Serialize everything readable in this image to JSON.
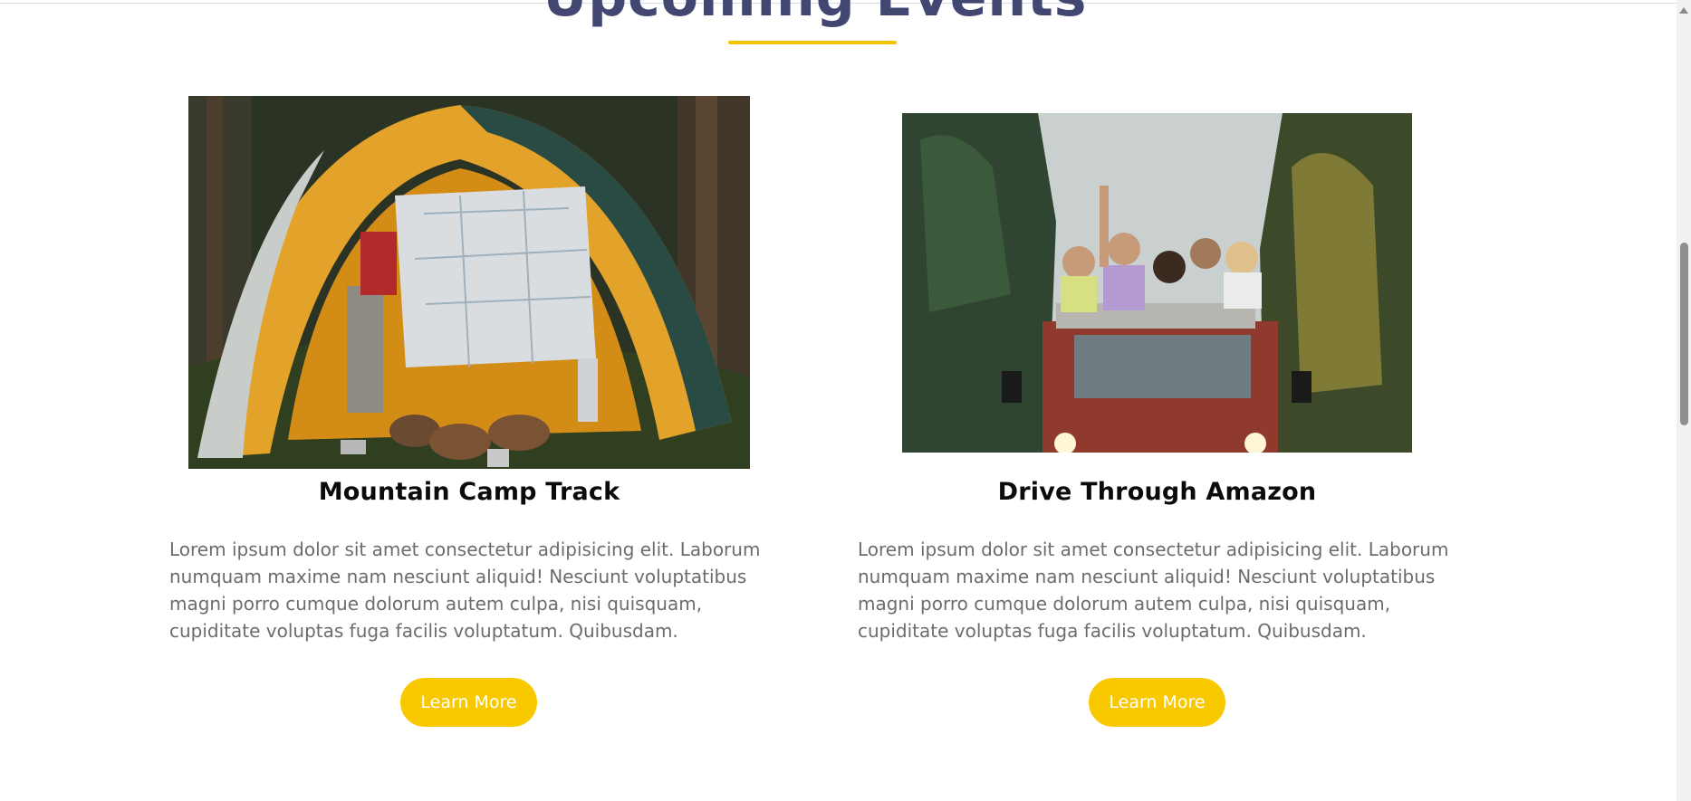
{
  "section": {
    "title": "Upcoming Events"
  },
  "events": [
    {
      "title": "Mountain Camp Track",
      "image_icon": "camping-tent-map-photo",
      "description": "Lorem ipsum dolor sit amet consectetur adipisicing elit. Laborum numquam maxime nam nesciunt aliquid! Nesciunt voluptatibus magni porro cumque dolorum autem culpa, nisi quisquam, cupiditate voluptas fuga facilis voluptatum. Quibusdam.",
      "button_label": "Learn More"
    },
    {
      "title": "Drive Through Amazon",
      "image_icon": "friends-on-van-forest-photo",
      "description": "Lorem ipsum dolor sit amet consectetur adipisicing elit. Laborum numquam maxime nam nesciunt aliquid! Nesciunt voluptatibus magni porro cumque dolorum autem culpa, nisi quisquam, cupiditate voluptas fuga facilis voluptatum. Quibusdam.",
      "button_label": "Learn More"
    }
  ],
  "colors": {
    "accent": "#f9c900",
    "heading": "#414770",
    "text": "#6c6c6c"
  }
}
